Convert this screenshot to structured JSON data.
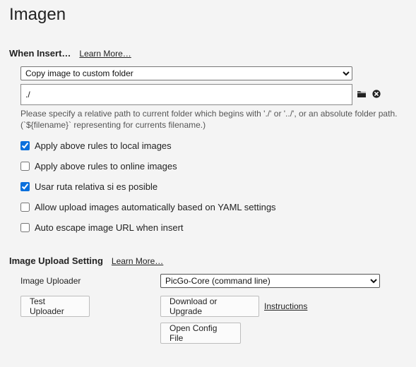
{
  "page": {
    "title": "Imagen"
  },
  "when_insert": {
    "title": "When Insert…",
    "learn_more": "Learn More…",
    "mode_options": [
      "Copy image to custom folder"
    ],
    "mode_selected": "Copy image to custom folder",
    "path_value": "./",
    "hint": "Please specify a relative path to current folder which begins with './' or '../', or an absolute folder path. (`${filename}` representing for currents filename.)",
    "icons": {
      "folder": "folder-icon",
      "clear": "clear-circle-icon"
    },
    "options": [
      {
        "label": "Apply above rules to local images",
        "checked": true
      },
      {
        "label": "Apply above rules to online images",
        "checked": false
      },
      {
        "label": "Usar ruta relativa si es posible",
        "checked": true
      },
      {
        "label": "Allow upload images automatically based on YAML settings",
        "checked": false
      },
      {
        "label": "Auto escape image URL when insert",
        "checked": false
      }
    ]
  },
  "upload": {
    "title": "Image Upload Setting",
    "learn_more": "Learn More…",
    "uploader_label": "Image Uploader",
    "uploader_options": [
      "PicGo-Core (command line)"
    ],
    "uploader_selected": "PicGo-Core (command line)",
    "test_button": "Test Uploader",
    "download_button": "Download or Upgrade",
    "instructions_link": "Instructions",
    "config_button": "Open Config File"
  },
  "colors": {
    "accent": "#0a6fdc",
    "background": "#f4f4f4"
  }
}
